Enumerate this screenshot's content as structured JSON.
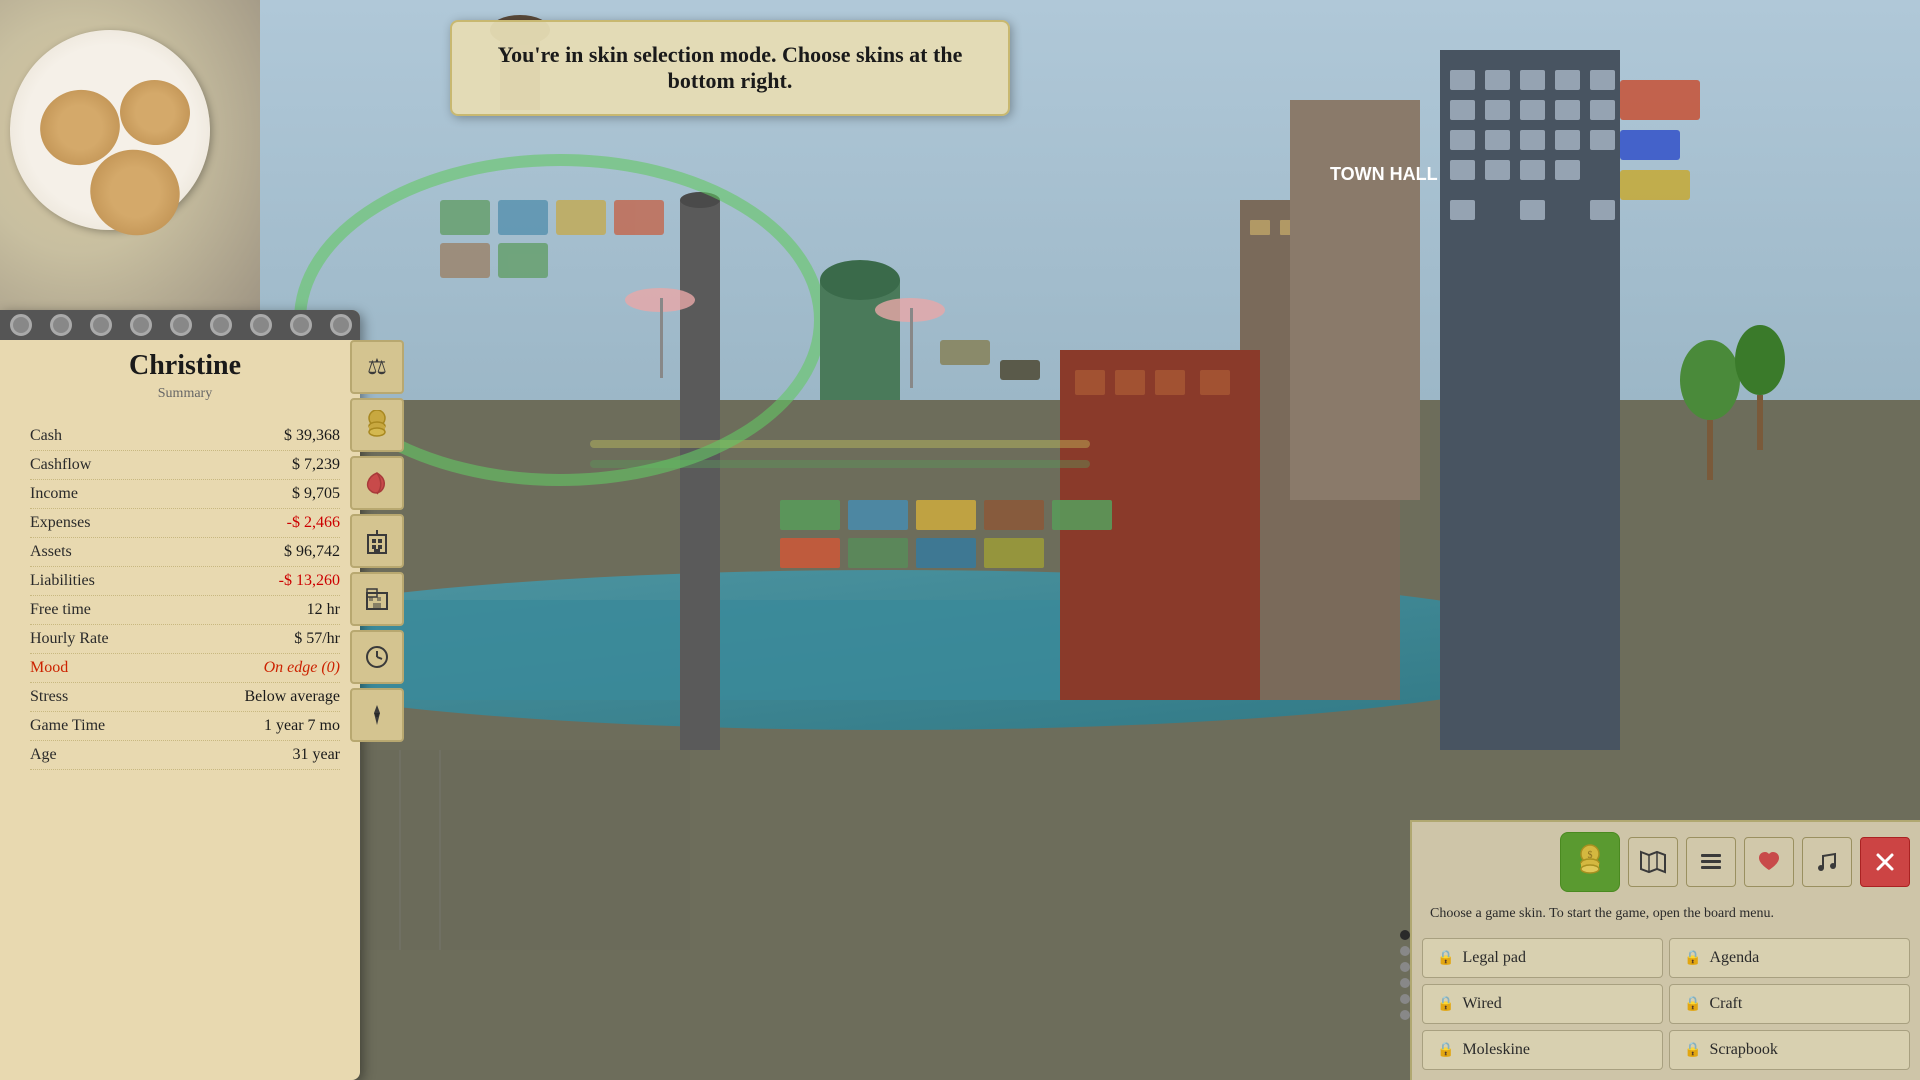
{
  "game": {
    "mode_message": "You're in skin selection mode. Choose skins at the bottom right.",
    "character_name": "Christine",
    "summary_label": "Summary"
  },
  "stats": [
    {
      "label": "Cash",
      "value": "$ 39,368",
      "negative": false
    },
    {
      "label": "Cashflow",
      "value": "$ 7,239",
      "negative": false
    },
    {
      "label": "Income",
      "value": "$ 9,705",
      "negative": false
    },
    {
      "label": "Expenses",
      "value": "-$ 2,466",
      "negative": true
    },
    {
      "label": "Assets",
      "value": "$ 96,742",
      "negative": false
    },
    {
      "label": "Liabilities",
      "value": "-$ 13,260",
      "negative": true
    },
    {
      "label": "Free time",
      "value": "12 hr",
      "negative": false
    },
    {
      "label": "Hourly Rate",
      "value": "$ 57/hr",
      "negative": false
    },
    {
      "label": "Mood",
      "value": "On edge (0)",
      "negative": false,
      "mood": true
    },
    {
      "label": "Stress",
      "value": "Below average",
      "negative": false
    },
    {
      "label": "Game Time",
      "value": "1 year 7 mo",
      "negative": false
    },
    {
      "label": "Age",
      "value": "31 year",
      "negative": false
    }
  ],
  "side_icons": [
    {
      "icon": "⚖",
      "name": "balance-icon"
    },
    {
      "icon": "🪙",
      "name": "coins-stack-icon"
    },
    {
      "icon": "🌿",
      "name": "plant-icon"
    },
    {
      "icon": "🏢",
      "name": "building-icon"
    },
    {
      "icon": "🏗",
      "name": "construction-icon"
    },
    {
      "icon": "⏱",
      "name": "clock-icon"
    },
    {
      "icon": "👔",
      "name": "tie-icon"
    }
  ],
  "panel": {
    "description": "Choose a game skin. To start the game, open the board menu.",
    "coins_icon": "🪙",
    "icons": [
      {
        "icon": "🗺",
        "name": "map-icon",
        "active": false
      },
      {
        "icon": "📋",
        "name": "clipboard-icon",
        "active": false
      },
      {
        "icon": "♥",
        "name": "heart-icon",
        "active": false
      },
      {
        "icon": "♪",
        "name": "music-icon",
        "active": false
      },
      {
        "icon": "✕",
        "name": "close-icon",
        "close": true
      }
    ],
    "skins": [
      {
        "label": "Legal pad",
        "locked": true
      },
      {
        "label": "Agenda",
        "locked": true
      },
      {
        "label": "Wired",
        "locked": true
      },
      {
        "label": "Craft",
        "locked": true
      },
      {
        "label": "Moleskine",
        "locked": true
      },
      {
        "label": "Scrapbook",
        "locked": true
      }
    ]
  },
  "colors": {
    "notebook_bg": "#e8d9b0",
    "panel_bg": "#d2c8aa",
    "accent_green": "#5a9a30",
    "mood_red": "#cc2200",
    "river_blue": "#3a8a9a"
  }
}
